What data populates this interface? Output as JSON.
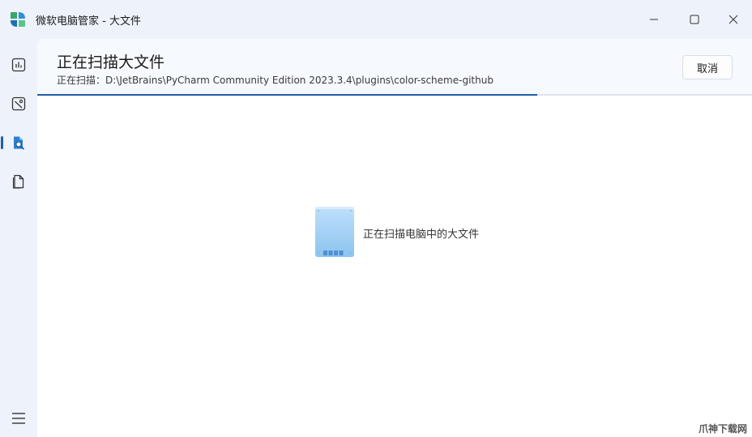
{
  "window": {
    "title": "微软电脑管家 - 大文件",
    "accent_color": "#1f5fa8"
  },
  "sidebar": {
    "items": [
      {
        "name": "dashboard",
        "icon": "chart-icon",
        "active": false
      },
      {
        "name": "cleanup",
        "icon": "disk-clean-icon",
        "active": false
      },
      {
        "name": "large-files",
        "icon": "file-search-icon",
        "active": true
      },
      {
        "name": "files",
        "icon": "document-icon",
        "active": false
      }
    ],
    "menu_icon": "hamburger-icon"
  },
  "header": {
    "title": "正在扫描大文件",
    "scan_path": "正在扫描：D:\\JetBrains\\PyCharm Community Edition 2023.3.4\\plugins\\color-scheme-github",
    "cancel_label": "取消",
    "progress_percent": 70
  },
  "main": {
    "status_text": "正在扫描电脑中的大文件"
  },
  "watermark": "爪神下载网"
}
